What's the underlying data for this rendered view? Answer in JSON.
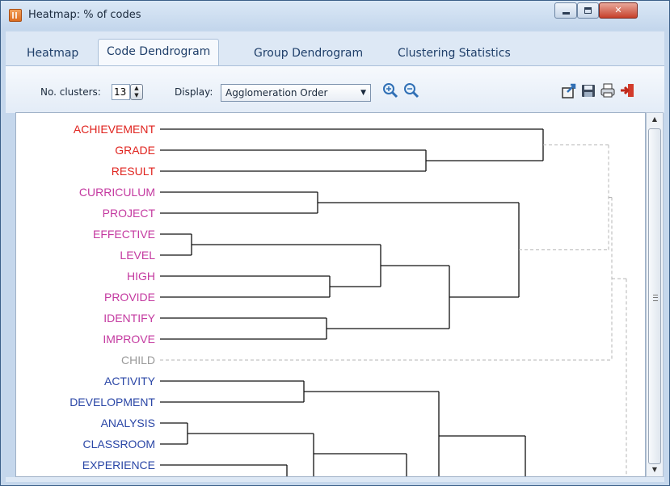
{
  "window": {
    "title": "Heatmap: % of codes"
  },
  "tabs": [
    {
      "label": "Heatmap"
    },
    {
      "label": "Code Dendrogram"
    },
    {
      "label": "Group Dendrogram"
    },
    {
      "label": "Clustering Statistics"
    }
  ],
  "toolbar": {
    "clusters_label": "No. clusters:",
    "clusters_value": "13",
    "display_label": "Display:",
    "display_value": "Agglomeration Order"
  },
  "icons": [
    "app-icon",
    "zoom-in-icon",
    "zoom-out-icon",
    "export-icon",
    "save-icon",
    "print-icon",
    "exit-icon"
  ],
  "colors": {
    "red": "#e0241f",
    "magenta": "#c43aa0",
    "gray": "#9a9a9a",
    "blue": "#2a46a6"
  },
  "dendrogram": {
    "codes": [
      {
        "label": "ACHIEVEMENT",
        "color": "#e0241f"
      },
      {
        "label": "GRADE",
        "color": "#e0241f"
      },
      {
        "label": "RESULT",
        "color": "#e0241f"
      },
      {
        "label": "CURRICULUM",
        "color": "#c43aa0"
      },
      {
        "label": "PROJECT",
        "color": "#c43aa0"
      },
      {
        "label": "EFFECTIVE",
        "color": "#c43aa0"
      },
      {
        "label": "LEVEL",
        "color": "#c43aa0"
      },
      {
        "label": "HIGH",
        "color": "#c43aa0"
      },
      {
        "label": "PROVIDE",
        "color": "#c43aa0"
      },
      {
        "label": "IDENTIFY",
        "color": "#c43aa0"
      },
      {
        "label": "IMPROVE",
        "color": "#c43aa0"
      },
      {
        "label": "CHILD",
        "color": "#9a9a9a"
      },
      {
        "label": "ACTIVITY",
        "color": "#2a46a6"
      },
      {
        "label": "DEVELOPMENT",
        "color": "#2a46a6"
      },
      {
        "label": "ANALYSIS",
        "color": "#2a46a6"
      },
      {
        "label": "CLASSROOM",
        "color": "#2a46a6"
      },
      {
        "label": "EXPERIENCE",
        "color": "#2a46a6"
      }
    ]
  }
}
